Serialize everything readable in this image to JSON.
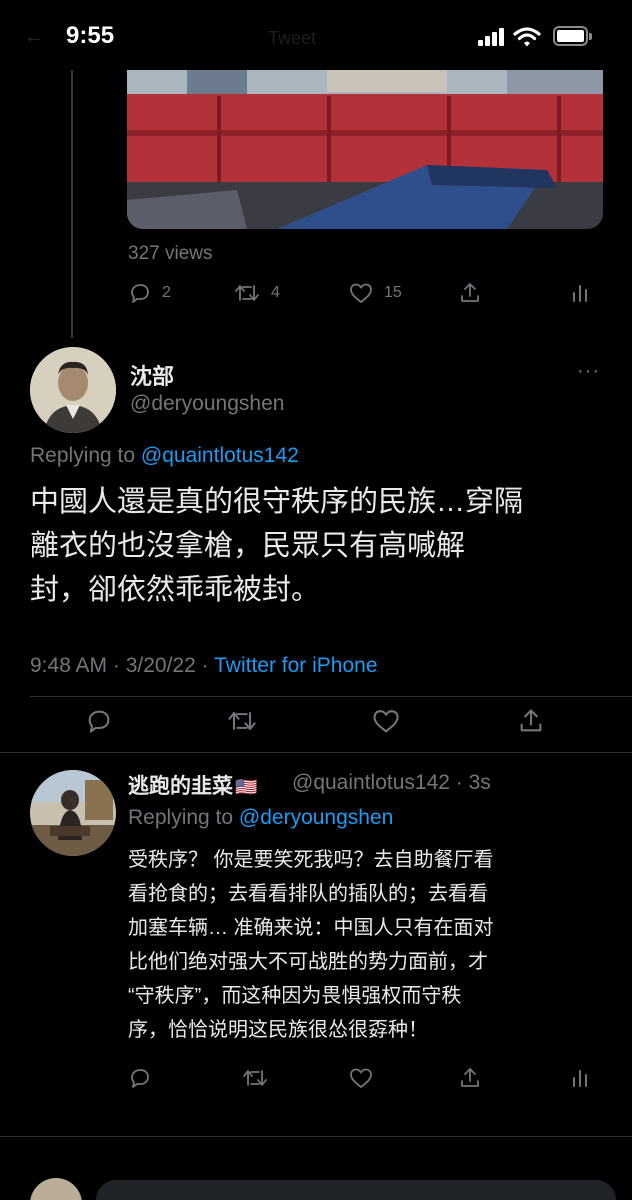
{
  "status_bar": {
    "time": "9:55",
    "faded_back": "←",
    "faded_title": "Tweet"
  },
  "previous_tweet": {
    "views": "327 views",
    "actions": {
      "reply_count": "2",
      "retweet_count": "4",
      "like_count": "15"
    }
  },
  "main_tweet": {
    "display_name": "沈部",
    "handle": "@deryoungshen",
    "more": "···",
    "replying_label": "Replying to",
    "replying_handle": "@quaintlotus142",
    "text_lines": [
      "中國人還是真的很守秩序的民族…穿隔",
      "離衣的也沒拿槍，民眾只有高喊解",
      "封，卻依然乖乖被封。"
    ],
    "time": "9:48 AM",
    "date": "3/20/22",
    "source": "Twitter for iPhone"
  },
  "reply_tweet": {
    "display_name": "逃跑的韭菜",
    "flag": "🇺🇸",
    "handle": "@quaintlotus142",
    "age": "3s",
    "replying_label": "Replying to",
    "replying_handle": "@deryoungshen",
    "text_lines": [
      "受秩序？ 你是要笑死我吗？去自助餐厅看",
      "看抢食的；去看看排队的插队的；去看看",
      "加塞车辆… 准确来说：中国人只有在面对",
      "比他们绝对强大不可战胜的势力面前，才",
      "“守秩序”，而这种因为畏惧强权而守秩",
      "序，恰恰说明这民族很怂很孬种！"
    ]
  },
  "colors": {
    "accent": "#1d9bf0",
    "muted": "#71767b",
    "text": "#e7e9ea",
    "background": "#000000"
  }
}
